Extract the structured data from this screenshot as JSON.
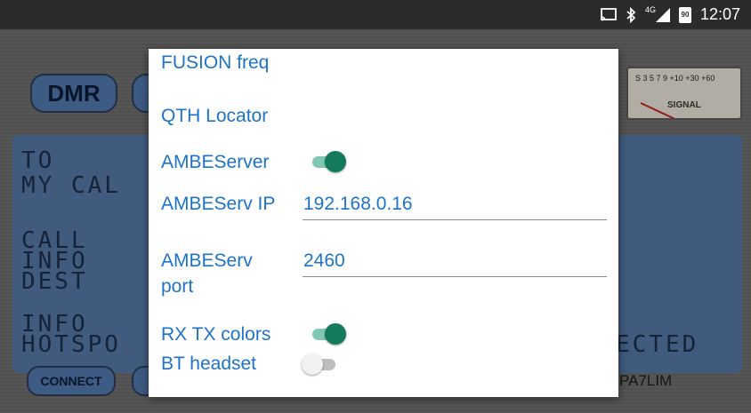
{
  "statusbar": {
    "cast_icon": "cast-icon",
    "bluetooth_icon": "bluetooth-icon",
    "signal_label": "4G",
    "battery_level": "90",
    "time": "12:07"
  },
  "background_app": {
    "mode_buttons": [
      "DMR"
    ],
    "meter": {
      "scale": "S 3 5 7 9 +10 +30 +60",
      "label": "SIGNAL"
    },
    "lcd_lines": [
      "TO",
      "MY CAL",
      "CALL",
      "INFO",
      "DEST",
      "INFO",
      "HOTSPO",
      "ECTED"
    ],
    "bottom_buttons": [
      "CONNECT"
    ],
    "callsign": "PA7LIM"
  },
  "dialog": {
    "fusion_freq_label": "FUSION freq",
    "qth_locator_label": "QTH Locator",
    "ambeserver_label": "AMBEServer",
    "ambeserver_enabled": true,
    "ambeserv_ip_label": "AMBEServ IP",
    "ambeserv_ip_value": "192.168.0.16",
    "ambeserv_port_label_line1": "AMBEServ",
    "ambeserv_port_label_line2": "port",
    "ambeserv_port_value": "2460",
    "rx_tx_colors_label": "RX TX colors",
    "rx_tx_colors_enabled": true,
    "bt_headset_label": "BT headset",
    "bt_headset_enabled": false
  },
  "colors": {
    "accent": "#1e73c8",
    "toggle_on": "#137a5c",
    "lcd_bg": "#4f6f9a"
  }
}
